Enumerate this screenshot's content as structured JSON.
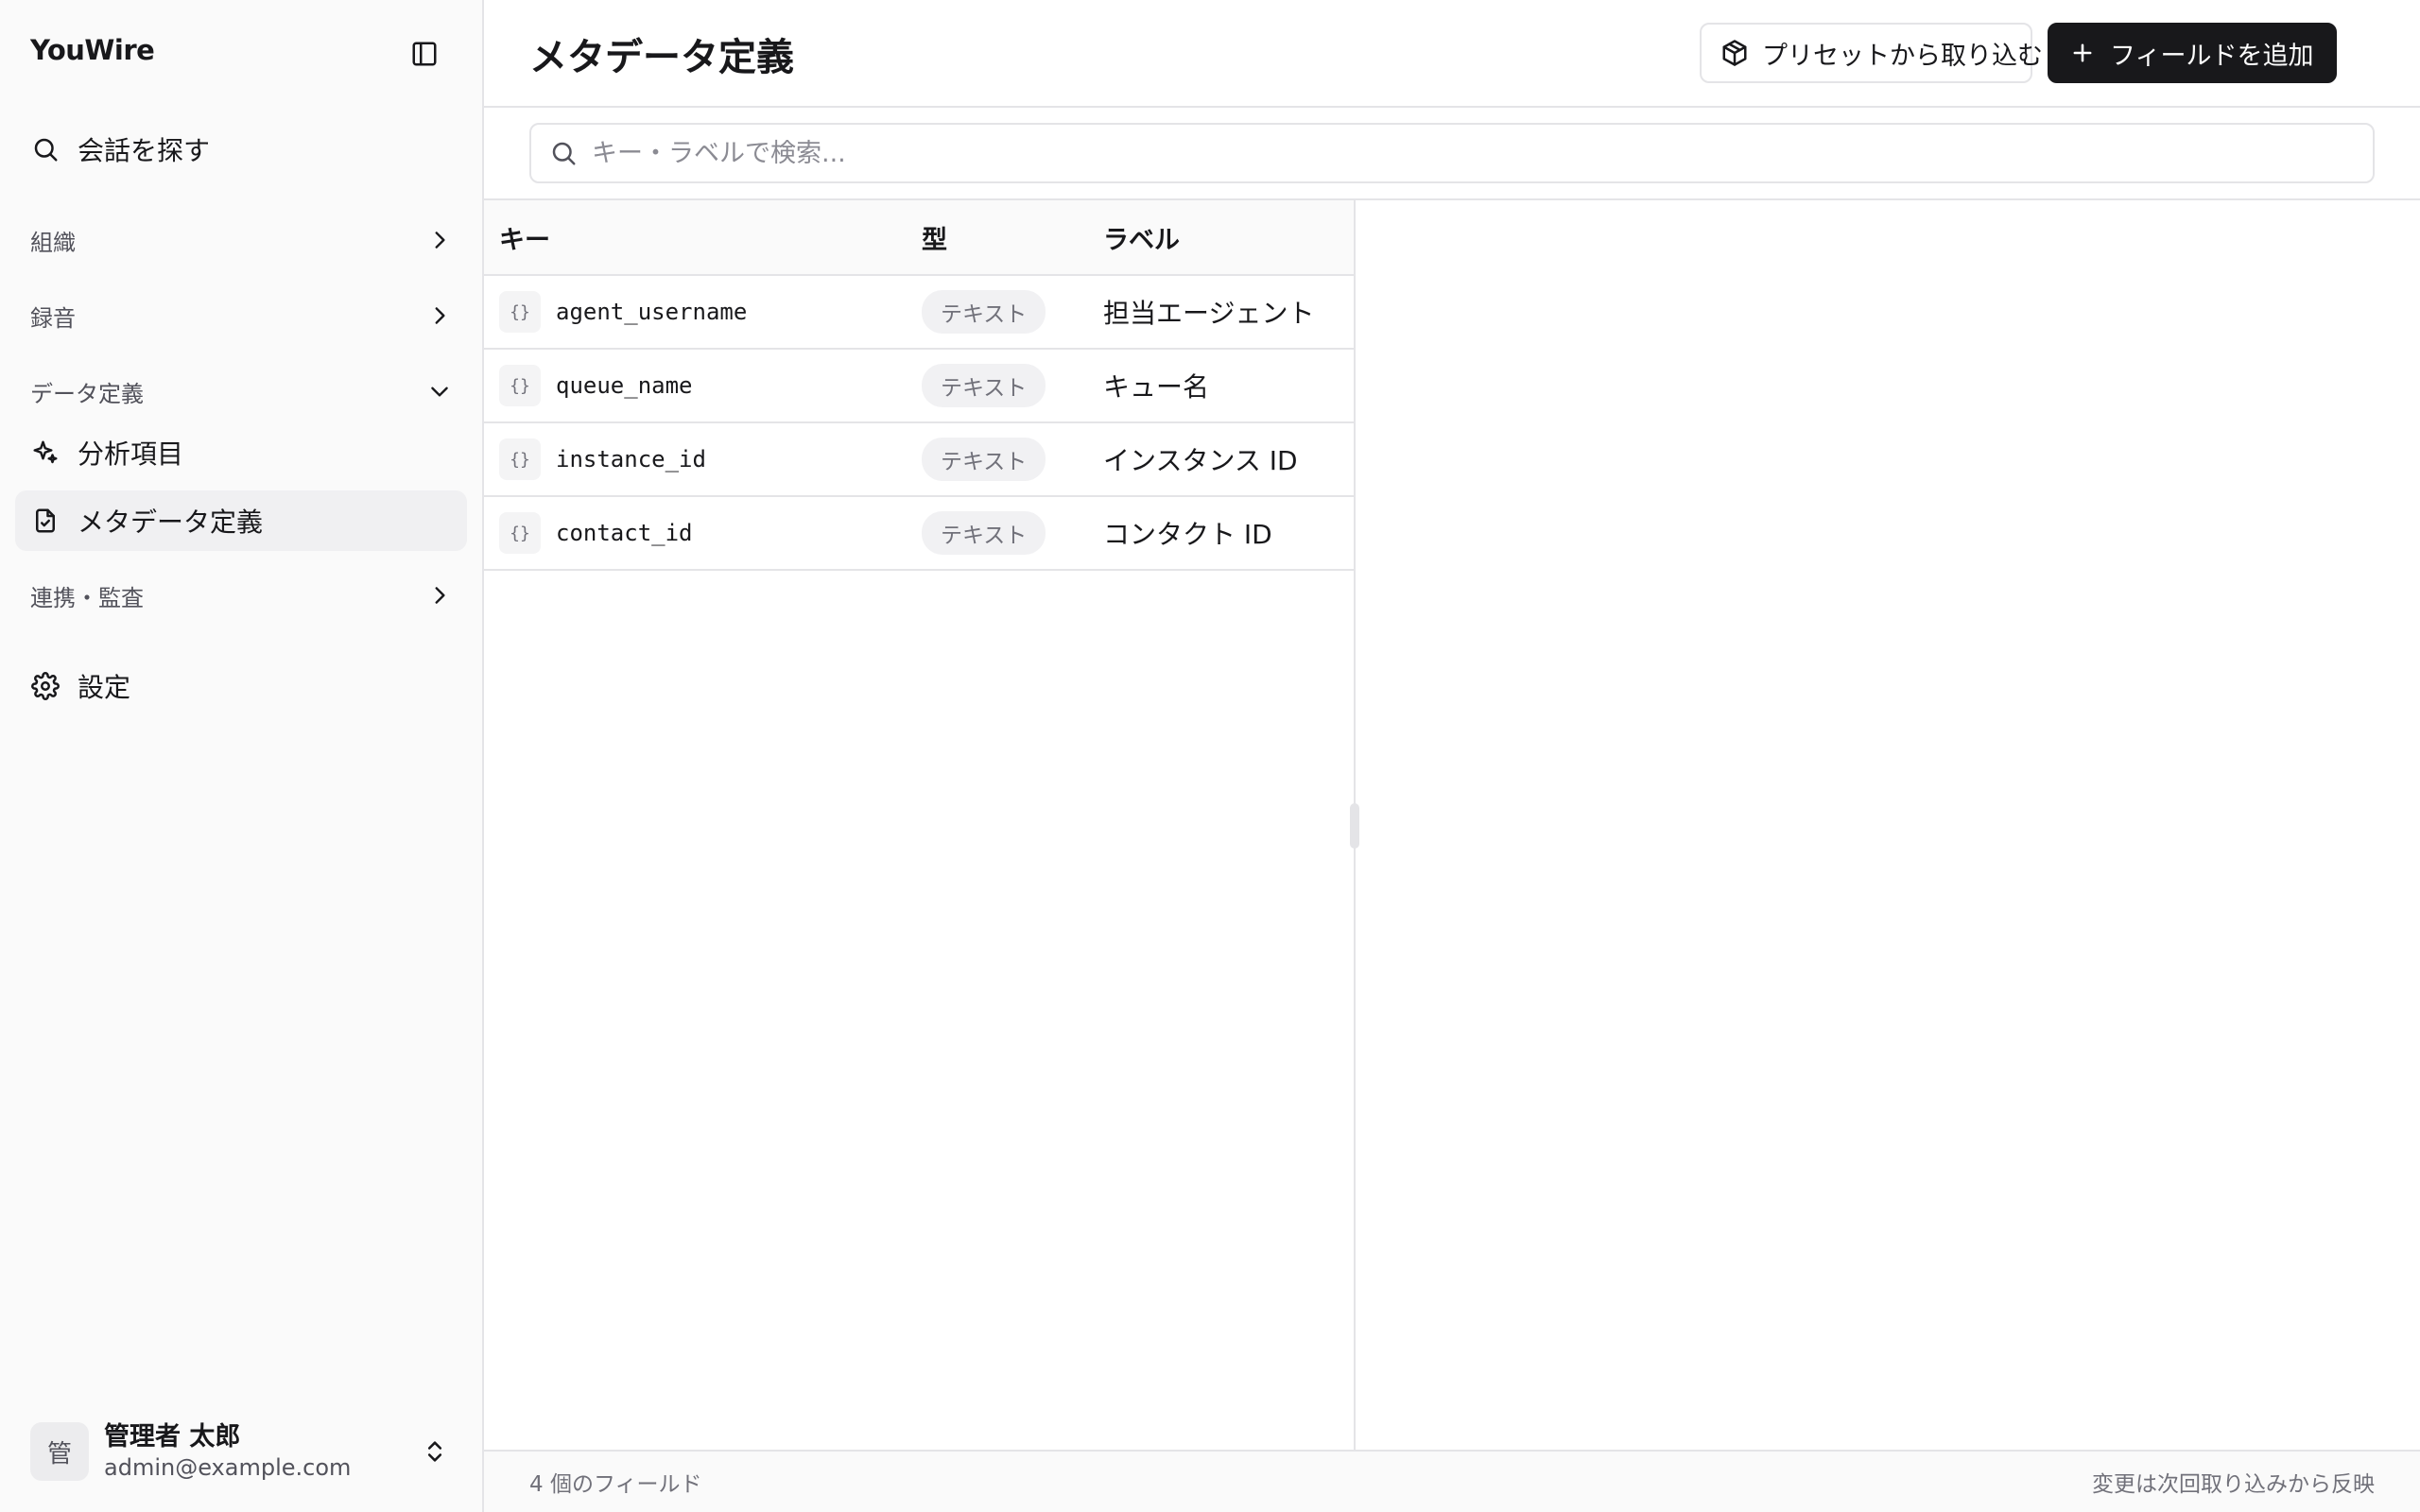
{
  "app": {
    "name": "YouWire"
  },
  "sidebar": {
    "search_label": "会話を探す",
    "groups": [
      {
        "label": "組織"
      },
      {
        "label": "録音"
      },
      {
        "label": "データ定義"
      },
      {
        "label": "連携・監査"
      }
    ],
    "items": [
      {
        "label": "分析項目",
        "icon": "sparkles-icon"
      },
      {
        "label": "メタデータ定義",
        "icon": "file-icon",
        "active": true
      }
    ],
    "settings_label": "設定",
    "user": {
      "avatar": "管",
      "name": "管理者 太郎",
      "email": "admin@example.com"
    }
  },
  "header": {
    "title": "メタデータ定義",
    "import_label": "プリセットから取り込む",
    "add_label": "フィールドを追加"
  },
  "search": {
    "placeholder": "キー・ラベルで検索..."
  },
  "table": {
    "headers": {
      "key": "キー",
      "type": "型",
      "label": "ラベル"
    },
    "key_icon": "{}",
    "rows": [
      {
        "key": "agent_username",
        "type": "テキスト",
        "label": "担当エージェント"
      },
      {
        "key": "queue_name",
        "type": "テキスト",
        "label": "キュー名"
      },
      {
        "key": "instance_id",
        "type": "テキスト",
        "label": "インスタンス ID"
      },
      {
        "key": "contact_id",
        "type": "テキスト",
        "label": "コンタクト ID"
      }
    ]
  },
  "footer": {
    "count": "4 個のフィールド",
    "note": "変更は次回取り込みから反映"
  },
  "colors": {
    "primary": "#18181b",
    "border": "#e4e4e7",
    "sidebar_bg": "#fafafa"
  }
}
